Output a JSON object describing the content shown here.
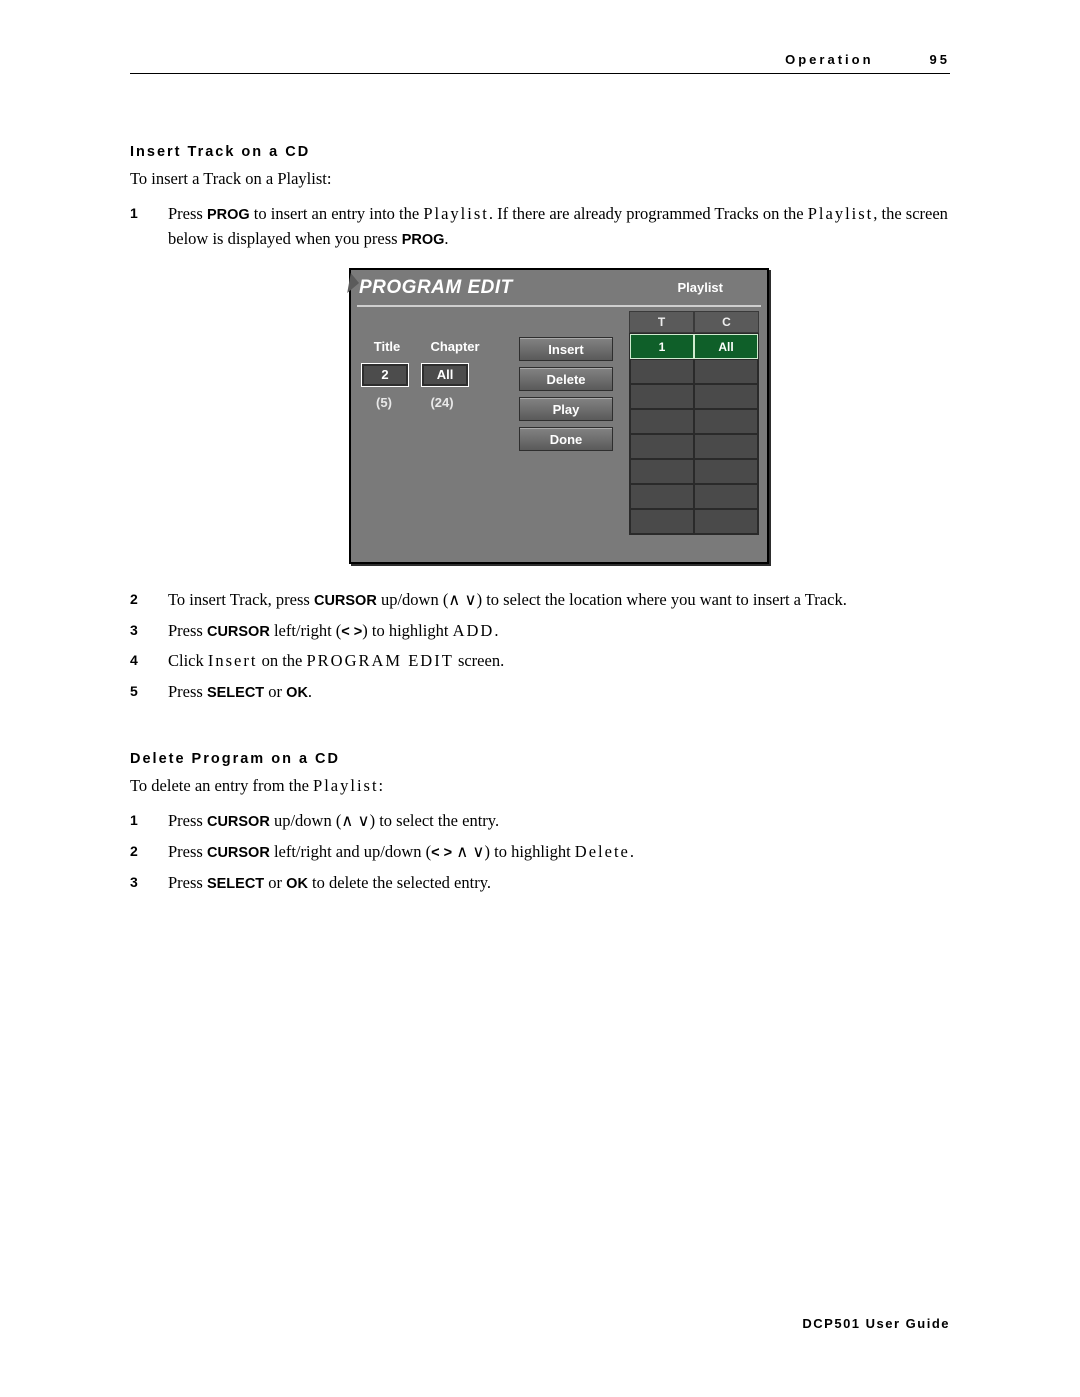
{
  "header": {
    "section": "Operation",
    "page_num": "95"
  },
  "footer": "DCP501 User Guide",
  "sec1": {
    "heading": "Insert Track on a CD",
    "intro": "To insert a Track on a Playlist:",
    "steps": [
      {
        "pre": "Press ",
        "kw": "PROG",
        "mid": " to insert an entry into the ",
        "mono": "Playlist",
        "mid2": ". If there are already programmed Tracks on the ",
        "mono2": "Playlist",
        "mid3": ", the screen below is displayed when you press ",
        "kw2": "PROG",
        "tail": "."
      },
      {
        "pre": "To insert Track, press ",
        "kw": "CURSOR",
        "mid": " up/down (∧ ∨) to select the location where you want to insert a Track."
      },
      {
        "pre": "Press ",
        "kw": "CURSOR",
        "mid": " left/right (",
        "b1": "< >",
        "mid2": ") to highlight ",
        "mono": "ADD",
        "tail": "."
      },
      {
        "pre": "Click ",
        "mono": "Insert",
        "mid": " on the ",
        "mono2": "PROGRAM EDIT",
        "tail": " screen."
      },
      {
        "pre": "Press ",
        "kw": "SELECT",
        "mid": " or ",
        "kw2": "OK",
        "tail": "."
      }
    ]
  },
  "sec2": {
    "heading": "Delete Program on a CD",
    "intro_pre": "To delete an entry from the ",
    "intro_mono": "Playlist",
    "intro_tail": ":",
    "steps": [
      {
        "pre": "Press ",
        "kw": "CURSOR",
        "mid": " up/down (∧ ∨) to select the entry."
      },
      {
        "pre": "Press ",
        "kw": "CURSOR",
        "mid": " left/right and up/down (",
        "b1": "< >",
        "mid2": " ∧ ∨) to highlight ",
        "mono": "Delete",
        "tail": "."
      },
      {
        "pre": "Press ",
        "kw": "SELECT",
        "mid": " or ",
        "kw2": "OK",
        "tail": " to delete the selected entry."
      }
    ]
  },
  "screen": {
    "title": "PROGRAM EDIT",
    "playlist_label": "Playlist",
    "col_title": "Title",
    "col_chapter": "Chapter",
    "title_val": "2",
    "chapter_val": "All",
    "title_total": "(5)",
    "chapter_total": "(24)",
    "buttons": {
      "insert": "Insert",
      "delete": "Delete",
      "play": "Play",
      "done": "Done"
    },
    "grid_head_t": "T",
    "grid_head_c": "C",
    "rows": [
      {
        "t": "1",
        "c": "All"
      },
      {
        "t": "",
        "c": ""
      },
      {
        "t": "",
        "c": ""
      },
      {
        "t": "",
        "c": ""
      },
      {
        "t": "",
        "c": ""
      },
      {
        "t": "",
        "c": ""
      },
      {
        "t": "",
        "c": ""
      },
      {
        "t": "",
        "c": ""
      }
    ]
  }
}
